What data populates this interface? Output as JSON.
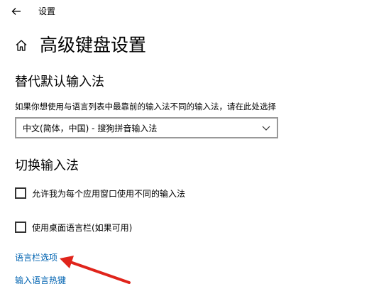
{
  "window": {
    "title": "设置"
  },
  "header": {
    "title": "高级键盘设置"
  },
  "override_input": {
    "heading": "替代默认输入法",
    "description": "如果你想使用与语言列表中最靠前的输入法不同的输入法，请在此处选择",
    "dropdown_value": "中文(简体，中国) - 搜狗拼音输入法"
  },
  "switch_input": {
    "heading": "切换输入法",
    "checkbox_per_app": "允许我为每个应用窗口使用不同的输入法",
    "checkbox_desktop_langbar": "使用桌面语言栏(如果可用)",
    "link_langbar_options": "语言栏选项",
    "link_hotkeys": "输入语言热键"
  },
  "colors": {
    "link": "#0063b1",
    "annotation_arrow": "#e0241b"
  },
  "icons": {
    "back": "back-arrow-icon",
    "home": "home-icon",
    "dropdown": "chevron-down-icon"
  }
}
